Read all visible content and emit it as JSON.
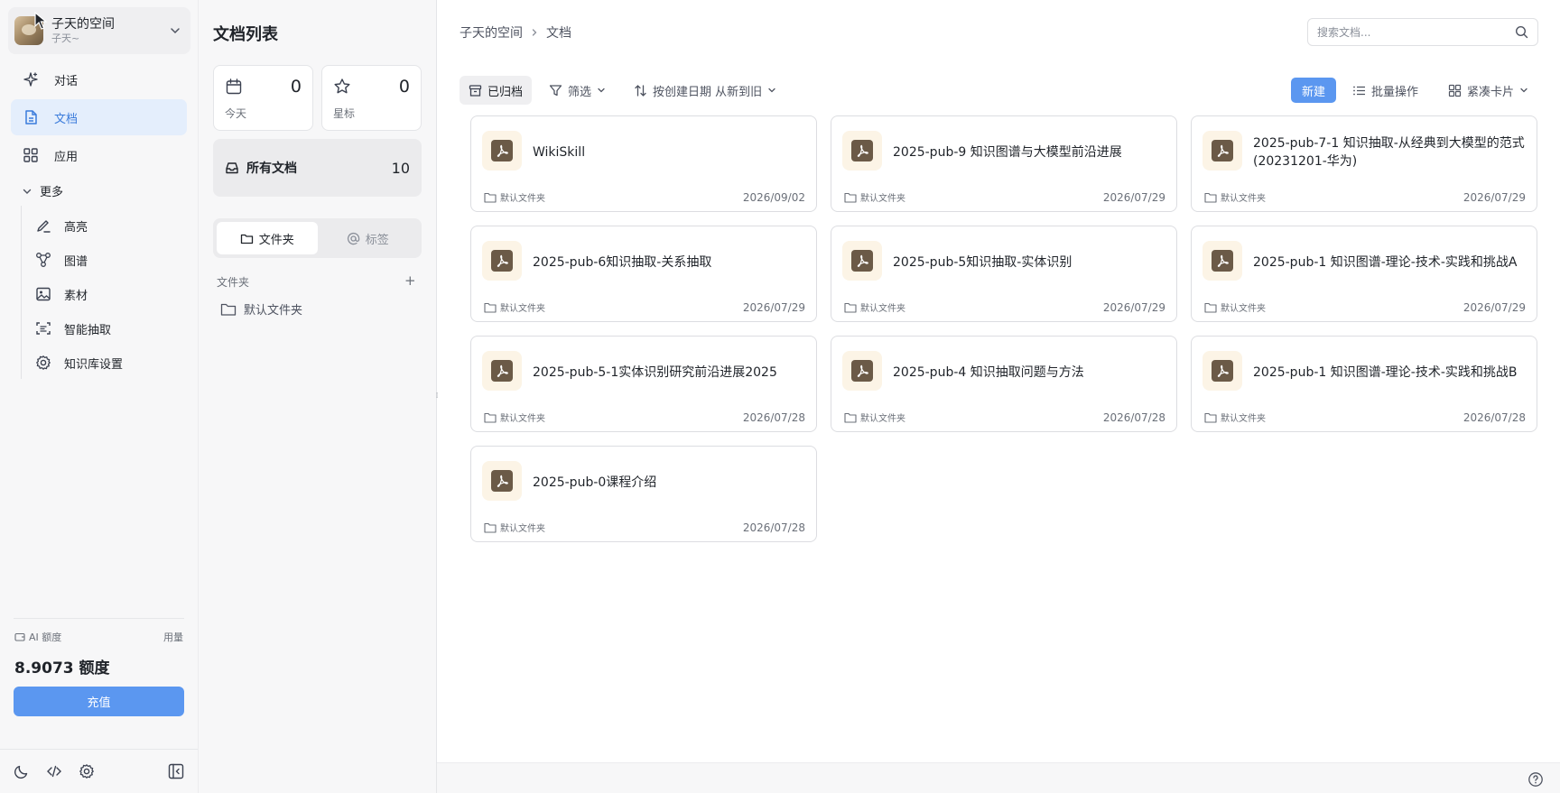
{
  "workspace": {
    "name": "子天的空间",
    "user": "子天~"
  },
  "nav": {
    "items": [
      {
        "label": "对话",
        "icon": "sparkle-icon"
      },
      {
        "label": "文档",
        "icon": "document-icon",
        "active": true
      },
      {
        "label": "应用",
        "icon": "apps-grid-icon"
      }
    ],
    "more_label": "更多",
    "sub_items": [
      {
        "label": "高亮",
        "icon": "highlight-icon"
      },
      {
        "label": "图谱",
        "icon": "graph-icon"
      },
      {
        "label": "素材",
        "icon": "image-icon"
      },
      {
        "label": "智能抽取",
        "icon": "scan-text-icon"
      },
      {
        "label": "知识库设置",
        "icon": "gear-icon"
      }
    ]
  },
  "quota": {
    "label": "AI 额度",
    "usage_label": "用量",
    "value": "8.9073 额度",
    "recharge_label": "充值"
  },
  "panel": {
    "title": "文档列表",
    "stats": [
      {
        "label": "今天",
        "count": "0"
      },
      {
        "label": "星标",
        "count": "0"
      }
    ],
    "all_docs": {
      "label": "所有文档",
      "count": "10"
    },
    "segments": {
      "folders": "文件夹",
      "tags": "标签"
    },
    "folder_heading": "文件夹",
    "folders": [
      "默认文件夹"
    ]
  },
  "breadcrumb": {
    "root": "子天的空间",
    "current": "文档"
  },
  "search": {
    "placeholder": "搜索文档..."
  },
  "toolbar": {
    "archived": "已归档",
    "filter": "筛选",
    "sort": "按创建日期 从新到旧",
    "new": "新建",
    "batch": "批量操作",
    "view": "紧凑卡片"
  },
  "documents": [
    {
      "title": "WikiSkill",
      "folder": "默认文件夹",
      "date": "2026/09/02"
    },
    {
      "title": "2025-pub-9 知识图谱与大模型前沿进展",
      "folder": "默认文件夹",
      "date": "2026/07/29"
    },
    {
      "title": "2025-pub-7-1 知识抽取-从经典到大模型的范式(20231201-华为)",
      "folder": "默认文件夹",
      "date": "2026/07/29"
    },
    {
      "title": "2025-pub-6知识抽取-关系抽取",
      "folder": "默认文件夹",
      "date": "2026/07/29"
    },
    {
      "title": "2025-pub-5知识抽取-实体识别",
      "folder": "默认文件夹",
      "date": "2026/07/29"
    },
    {
      "title": "2025-pub-1 知识图谱-理论-技术-实践和挑战A",
      "folder": "默认文件夹",
      "date": "2026/07/29"
    },
    {
      "title": "2025-pub-5-1实体识别研究前沿进展2025",
      "folder": "默认文件夹",
      "date": "2026/07/28"
    },
    {
      "title": "2025-pub-4 知识抽取问题与方法",
      "folder": "默认文件夹",
      "date": "2026/07/28"
    },
    {
      "title": "2025-pub-1 知识图谱-理论-技术-实践和挑战B",
      "folder": "默认文件夹",
      "date": "2026/07/28"
    },
    {
      "title": "2025-pub-0课程介绍",
      "folder": "默认文件夹",
      "date": "2026/07/28"
    }
  ],
  "colors": {
    "accent": "#5b97f0",
    "active_bg": "#e4eefc",
    "active_text": "#3a7bdb",
    "pdf_icon": "#6b5a47"
  }
}
